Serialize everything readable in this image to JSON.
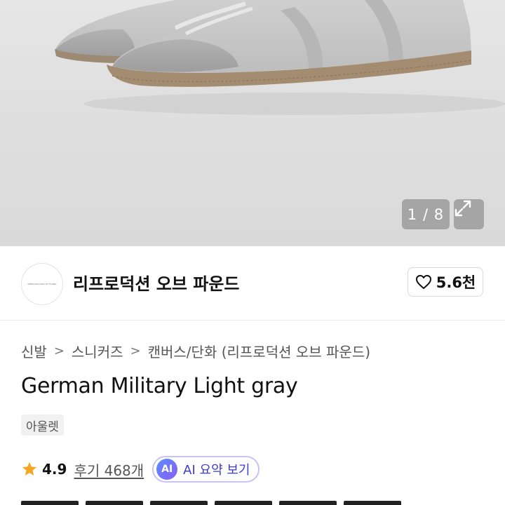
{
  "gallery": {
    "counter": "1 / 8",
    "expand_icon": "expand-icon"
  },
  "shop": {
    "logo_text": "REPRODUCTION OF FOUND",
    "name": "리프로덕션 오브 파운드",
    "likes": "5.6천",
    "heart_icon": "heart-icon"
  },
  "breadcrumb": {
    "items": [
      "신발",
      "스니커즈",
      "캔버스/단화 (리프로덕션 오브 파운드)"
    ],
    "separator": ">"
  },
  "product": {
    "title": "German Military Light gray",
    "tag": "아울렛",
    "rating": "4.9",
    "reviews": "후기 468개",
    "ai_badge": "AI",
    "ai_label": "AI 요약 보기"
  },
  "colors": {
    "star": "#f5a623",
    "ai_border": "#c9c2f3",
    "ai_text": "#3b3bd6"
  }
}
